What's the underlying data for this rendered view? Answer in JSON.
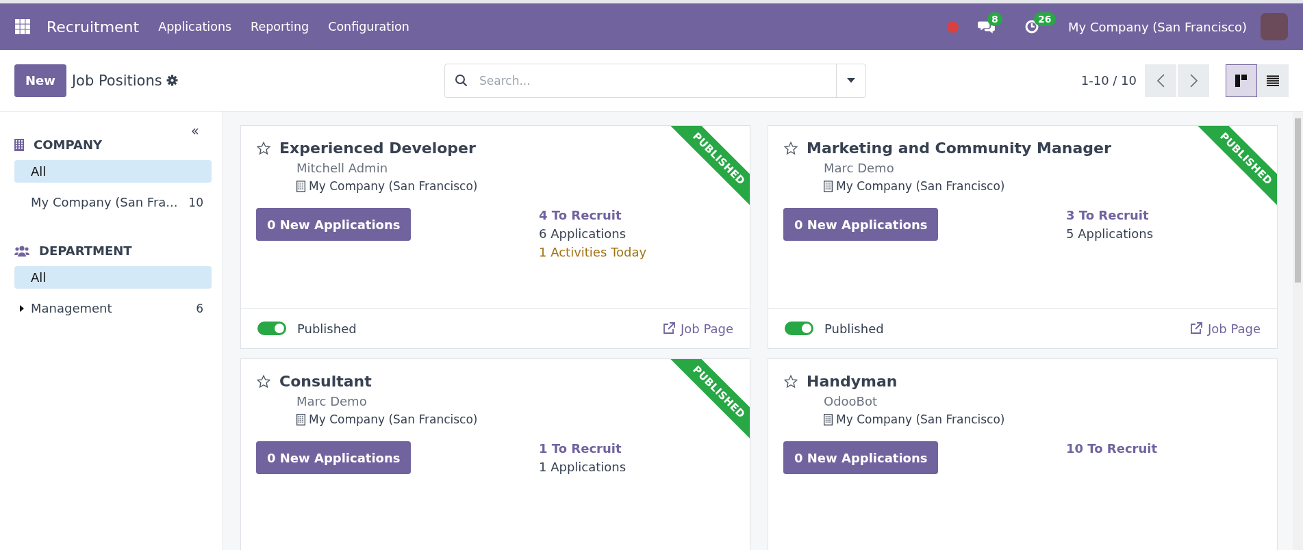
{
  "navbar": {
    "app_name": "Recruitment",
    "menu": [
      "Applications",
      "Reporting",
      "Configuration"
    ],
    "messages_count": "8",
    "activities_count": "26",
    "company": "My Company (San Francisco)"
  },
  "control_panel": {
    "new_button": "New",
    "title": "Job Positions",
    "search": {
      "placeholder": "Search..."
    },
    "pager": "1-10 / 10",
    "views": [
      {
        "kind": "kanban",
        "selected": true
      },
      {
        "kind": "list",
        "selected": false
      }
    ]
  },
  "sidebar": {
    "sections": [
      {
        "kind": "company",
        "title": "COMPANY",
        "items": [
          {
            "label": "All",
            "selected": true,
            "expandable": false
          },
          {
            "label": "My Company (San Fra...",
            "count": "10",
            "selected": false,
            "expandable": false
          }
        ]
      },
      {
        "kind": "department",
        "title": "DEPARTMENT",
        "items": [
          {
            "label": "All",
            "selected": true,
            "expandable": false
          },
          {
            "label": "Management",
            "count": "6",
            "selected": false,
            "expandable": true
          }
        ]
      }
    ]
  },
  "cards": [
    {
      "title": "Experienced Developer",
      "starred": false,
      "ribbon": "PUBLISHED",
      "manager": "Mitchell Admin",
      "company": "My Company (San Francisco)",
      "new_applications": "0 New Applications",
      "stats": [
        {
          "kind": "recruit",
          "text": "4 To Recruit"
        },
        {
          "kind": "applications",
          "text": "6 Applications"
        },
        {
          "kind": "activities",
          "text": "1 Activities Today"
        }
      ],
      "footer": {
        "published": true,
        "published_label": "Published",
        "job_page": "Job Page"
      }
    },
    {
      "title": "Marketing and Community Manager",
      "starred": false,
      "ribbon": "PUBLISHED",
      "manager": "Marc Demo",
      "company": "My Company (San Francisco)",
      "new_applications": "0 New Applications",
      "stats": [
        {
          "kind": "recruit",
          "text": "3 To Recruit"
        },
        {
          "kind": "applications",
          "text": "5 Applications"
        }
      ],
      "footer": {
        "published": true,
        "published_label": "Published",
        "job_page": "Job Page"
      }
    },
    {
      "title": "Consultant",
      "starred": false,
      "ribbon": "PUBLISHED",
      "manager": "Marc Demo",
      "company": "My Company (San Francisco)",
      "new_applications": "0 New Applications",
      "stats": [
        {
          "kind": "recruit",
          "text": "1 To Recruit"
        },
        {
          "kind": "applications",
          "text": "1 Applications"
        }
      ]
    },
    {
      "title": "Handyman",
      "starred": false,
      "manager": "OdooBot",
      "company": "My Company (San Francisco)",
      "new_applications": "0 New Applications",
      "stats": [
        {
          "kind": "recruit",
          "text": "10 To Recruit"
        }
      ]
    }
  ]
}
